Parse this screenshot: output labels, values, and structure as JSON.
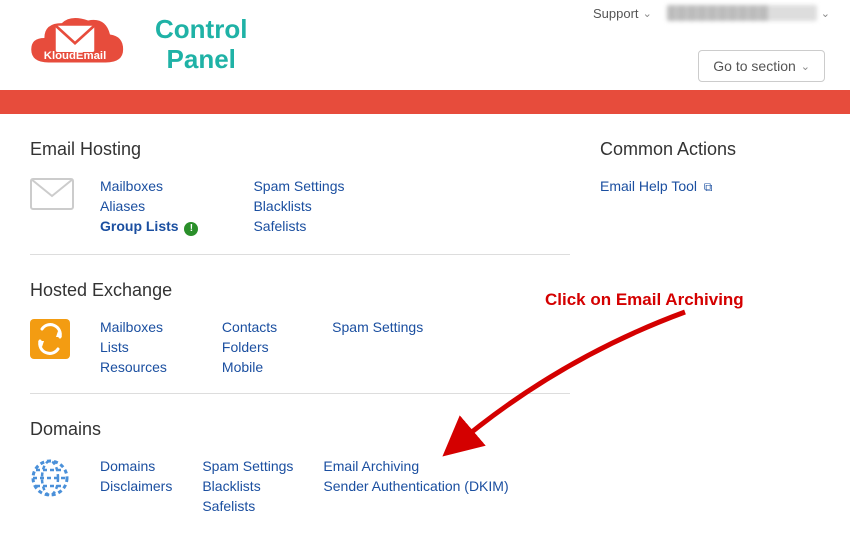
{
  "header": {
    "logo_text": "KloudEmail",
    "title_line1": "Control",
    "title_line2": "Panel",
    "support_label": "Support",
    "user_label_placeholder": "██████████",
    "goto_label": "Go to section"
  },
  "sections": {
    "email_hosting": {
      "title": "Email Hosting",
      "col1": {
        "mailboxes": "Mailboxes",
        "aliases": "Aliases",
        "group_lists": "Group Lists"
      },
      "col2": {
        "spam": "Spam Settings",
        "blacklists": "Blacklists",
        "safelists": "Safelists"
      }
    },
    "hosted_exchange": {
      "title": "Hosted Exchange",
      "col1": {
        "mailboxes": "Mailboxes",
        "lists": "Lists",
        "resources": "Resources"
      },
      "col2": {
        "contacts": "Contacts",
        "folders": "Folders",
        "mobile": "Mobile"
      },
      "col3": {
        "spam": "Spam Settings"
      }
    },
    "domains": {
      "title": "Domains",
      "col1": {
        "domains": "Domains",
        "disclaimers": "Disclaimers"
      },
      "col2": {
        "spam": "Spam Settings",
        "blacklists": "Blacklists",
        "safelists": "Safelists"
      },
      "col3": {
        "archiving": "Email Archiving",
        "dkim": "Sender Authentication (DKIM)"
      }
    }
  },
  "sidebar": {
    "title": "Common Actions",
    "help_tool": "Email Help Tool"
  },
  "annotation": {
    "text": "Click on Email Archiving"
  }
}
